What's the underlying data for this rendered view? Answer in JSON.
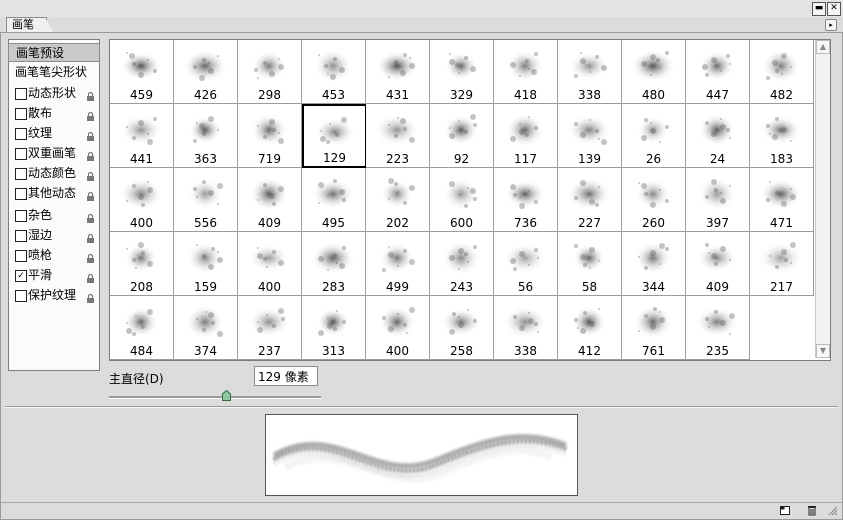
{
  "window": {
    "tab_label": "画笔",
    "minimize_label": "▬",
    "close_label": "✕",
    "menu_label": "▸"
  },
  "sidebar": {
    "items": [
      {
        "label": "画笔预设",
        "checkbox": false,
        "checked": false,
        "lock": false,
        "selected": true
      },
      {
        "label": "画笔笔尖形状",
        "checkbox": false,
        "checked": false,
        "lock": false,
        "selected": false
      },
      {
        "label": "动态形状",
        "checkbox": true,
        "checked": false,
        "lock": true,
        "selected": false
      },
      {
        "label": "散布",
        "checkbox": true,
        "checked": false,
        "lock": true,
        "selected": false
      },
      {
        "label": "纹理",
        "checkbox": true,
        "checked": false,
        "lock": true,
        "selected": false
      },
      {
        "label": "双重画笔",
        "checkbox": true,
        "checked": false,
        "lock": true,
        "selected": false
      },
      {
        "label": "动态颜色",
        "checkbox": true,
        "checked": false,
        "lock": true,
        "selected": false
      },
      {
        "label": "其他动态",
        "checkbox": true,
        "checked": false,
        "lock": true,
        "selected": false
      },
      {
        "label": "杂色",
        "checkbox": true,
        "checked": false,
        "lock": true,
        "selected": false
      },
      {
        "label": "湿边",
        "checkbox": true,
        "checked": false,
        "lock": true,
        "selected": false
      },
      {
        "label": "喷枪",
        "checkbox": true,
        "checked": false,
        "lock": true,
        "selected": false
      },
      {
        "label": "平滑",
        "checkbox": true,
        "checked": true,
        "lock": true,
        "selected": false
      },
      {
        "label": "保护纹理",
        "checkbox": true,
        "checked": false,
        "lock": true,
        "selected": false
      }
    ]
  },
  "brushes": [
    "459",
    "426",
    "298",
    "453",
    "431",
    "329",
    "418",
    "338",
    "480",
    "447",
    "482",
    "441",
    "363",
    "719",
    "129",
    "223",
    "92",
    "117",
    "139",
    "26",
    "24",
    "183",
    "400",
    "556",
    "409",
    "495",
    "202",
    "600",
    "736",
    "227",
    "260",
    "397",
    "471",
    "208",
    "159",
    "400",
    "283",
    "499",
    "243",
    "56",
    "58",
    "344",
    "409",
    "217",
    "484",
    "374",
    "237",
    "313",
    "400",
    "258",
    "338",
    "412",
    "761",
    "235"
  ],
  "selected_brush_index": 14,
  "diameter": {
    "label": "主直径(D)",
    "value": "129 像素",
    "slider_fraction": 0.55
  },
  "scroll": {
    "up": "▲",
    "down": "▼"
  }
}
